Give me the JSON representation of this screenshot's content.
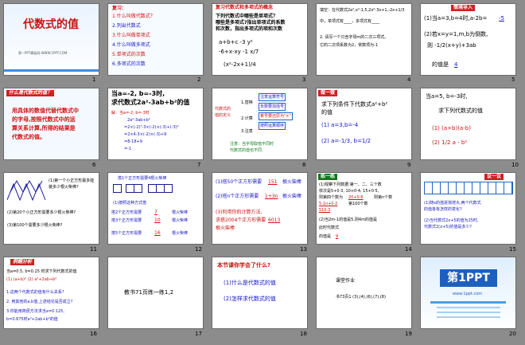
{
  "slides": [
    {
      "num": "1",
      "title": "代数式的值",
      "sub": "第一PPT模板网-WWW.1PPT.COM"
    },
    {
      "num": "2",
      "line1": "复习：",
      "q1": "1.什么叫做代数式？",
      "q2": "2.列出代数式",
      "q3": "3.什么叫做单项式",
      "q4": "4.什么叫做多项式",
      "q5": "5.单项式的次数",
      "q6": "6.多项式的次数"
    },
    {
      "num": "3",
      "head": "复习代数式和多项式的概念",
      "l1": "下列代数式中哪些是单项式？",
      "l2": "哪些是多项式?指出单项式的系数",
      "l3": "和次数，指出多项式的项和次数",
      "f1": "a+b+c  -3  y²",
      "f2": "-6+x-xy  -1  x/7",
      "f3": "(x²-2x+1)/4"
    },
    {
      "num": "4",
      "l1": "填空：在代数式2a²,x²-1,5,2x²-3x+1,-2x+1/3",
      "l2": "中，单项式有____，多项式有____",
      "l3": "2. 请写一个只含字母m的二次三项式。",
      "l4": "它的二次项系数为2，常数项为-1"
    },
    {
      "num": "5",
      "head": "情境导入",
      "l1": "(1)当a=3,b=4时,a-2b=",
      "a1": "-5",
      "l2": "(2)若x=y=1,m,b为倒数,",
      "l3": "则 -1/2(x+y)+3ab",
      "l4": "的值是",
      "a2": "4"
    },
    {
      "num": "6",
      "head": "什么是代数式的值？",
      "l1": "用具体的数值代替代数式中",
      "l2": "的字母,按照代数式中的运",
      "l3": "算关系计算,所得的结果是",
      "l4": "代数式的值。"
    },
    {
      "num": "7",
      "l1": "当a=-2, b=-3时,",
      "l2": "求代数式2a²-3ab+b²的值",
      "l3": "解：当a=-2, b=-3时",
      "l4": "2a²-3ab+b²",
      "l5": "=2×(-2)²-3×(-2)×(-3)+(-3)²",
      "l6": "=2×4-3×(-2)×(-3)+9",
      "l7": "=8-18+9",
      "l8": "=-1"
    },
    {
      "num": "8",
      "l1": "代数式的值的定义",
      "s1": "1.替换",
      "s2": "2.计算",
      "s3": "3.注意",
      "n1": "注意运算符号",
      "n2": "负数要加括号",
      "n3": "乘号要还原为\"×\"",
      "n4": "按照运算顺序",
      "n5": "注意：当字母取值不同时",
      "n6": "代数式的值也不同"
    },
    {
      "num": "9",
      "head": "做一做",
      "l1": "求下列条件下代数式a²+b²",
      "l2": "的值",
      "l3": "(1) a=3,b=-4",
      "l4": "(2) a=-1/3, b=1/2"
    },
    {
      "num": "10",
      "l1": "当a=5, b=-3时,",
      "l2": "求下列代数式的值",
      "l3": "(1) (a+b)(a-b)",
      "l4": "(2) 1/2 a - b²"
    },
    {
      "num": "11",
      "l1": "(1)第一个小正方形最多能",
      "l2": "装多少根火柴棒?",
      "l3": "(2)第20个小正方形需要多少根火柴棒?",
      "l4": "(3)第100个需要多少根火柴棒?"
    },
    {
      "num": "12",
      "l1": "搭1个正方形需要4根火柴棒",
      "l2": "(1)按照这种方式搭",
      "l3": "搭2个正方形需要",
      "a1": "7",
      "u1": "根火柴棒",
      "l4": "搭3个正方形需要",
      "a2": "10",
      "u2": "根火柴棒",
      "l5": "搭5个正方形需要",
      "a3": "16",
      "u3": "根火柴棒"
    },
    {
      "num": "13",
      "l1": "(1)搭50个正方形需要",
      "a1": "151",
      "l2": "根火柴棒",
      "l3": "(2)搭n个正方形需要",
      "a2": "1+3n",
      "l4": "根火柴棒",
      "l5": "(3)利用你的计算方法,",
      "l6": "求搭2004个正方形需要",
      "a3": "6013",
      "l7": "根火柴棒"
    },
    {
      "num": "14",
      "head": "练一练",
      "l1": "(1)观察下列数据:第一、二、三个数",
      "l2": "依次是5+0·3, 10+0·4, 15+0·5,",
      "l3": "则第四个数为",
      "a1": "20+0·6",
      "l4": "则第n个数",
      "a2": "5·1n+0·2",
      "l5": "第100个数",
      "a3": "510·3",
      "l6": "(2)当2m-1的值是5,则4m的值是",
      "l7": "此时代数式",
      "l8": "的值是",
      "a4": "9"
    },
    {
      "num": "15",
      "head": "议一议",
      "l1": "(1)随x的值逐渐增大,两个代数式",
      "l2": "的值各有怎样的变化?",
      "l3": "(2)当代数式2x+5的值为25时,",
      "l4": "代数式2(x+5)的值是多少?"
    },
    {
      "num": "16",
      "head": "例题分析",
      "l1": "当a=0.5, b=0.25 时求下列代数式的值",
      "l2": "(1) (a+b)²  (2) a²+2ab+b²",
      "l3": "1.这两个代数式的值有什么关系?",
      "l4": "2. 用其他的a,b值,上述结论是否成立?",
      "l5": "3.你能用简便方法求当a=0.125,",
      "l6": "b=0.875时a²+2ab+b²的值"
    },
    {
      "num": "17",
      "l1": "教书71页练一练1,2"
    },
    {
      "num": "18",
      "head": "本节课你学会了什么?",
      "l1": "(1)什么是代数式的值",
      "l2": "(2)怎样求代数式的值"
    },
    {
      "num": "19",
      "l1": "课堂作业",
      "l2": "书73页1 (3),(4),(6),(7),(8)"
    },
    {
      "num": "20",
      "logo": "第1PPT",
      "sub": "www.1ppt.com"
    }
  ]
}
